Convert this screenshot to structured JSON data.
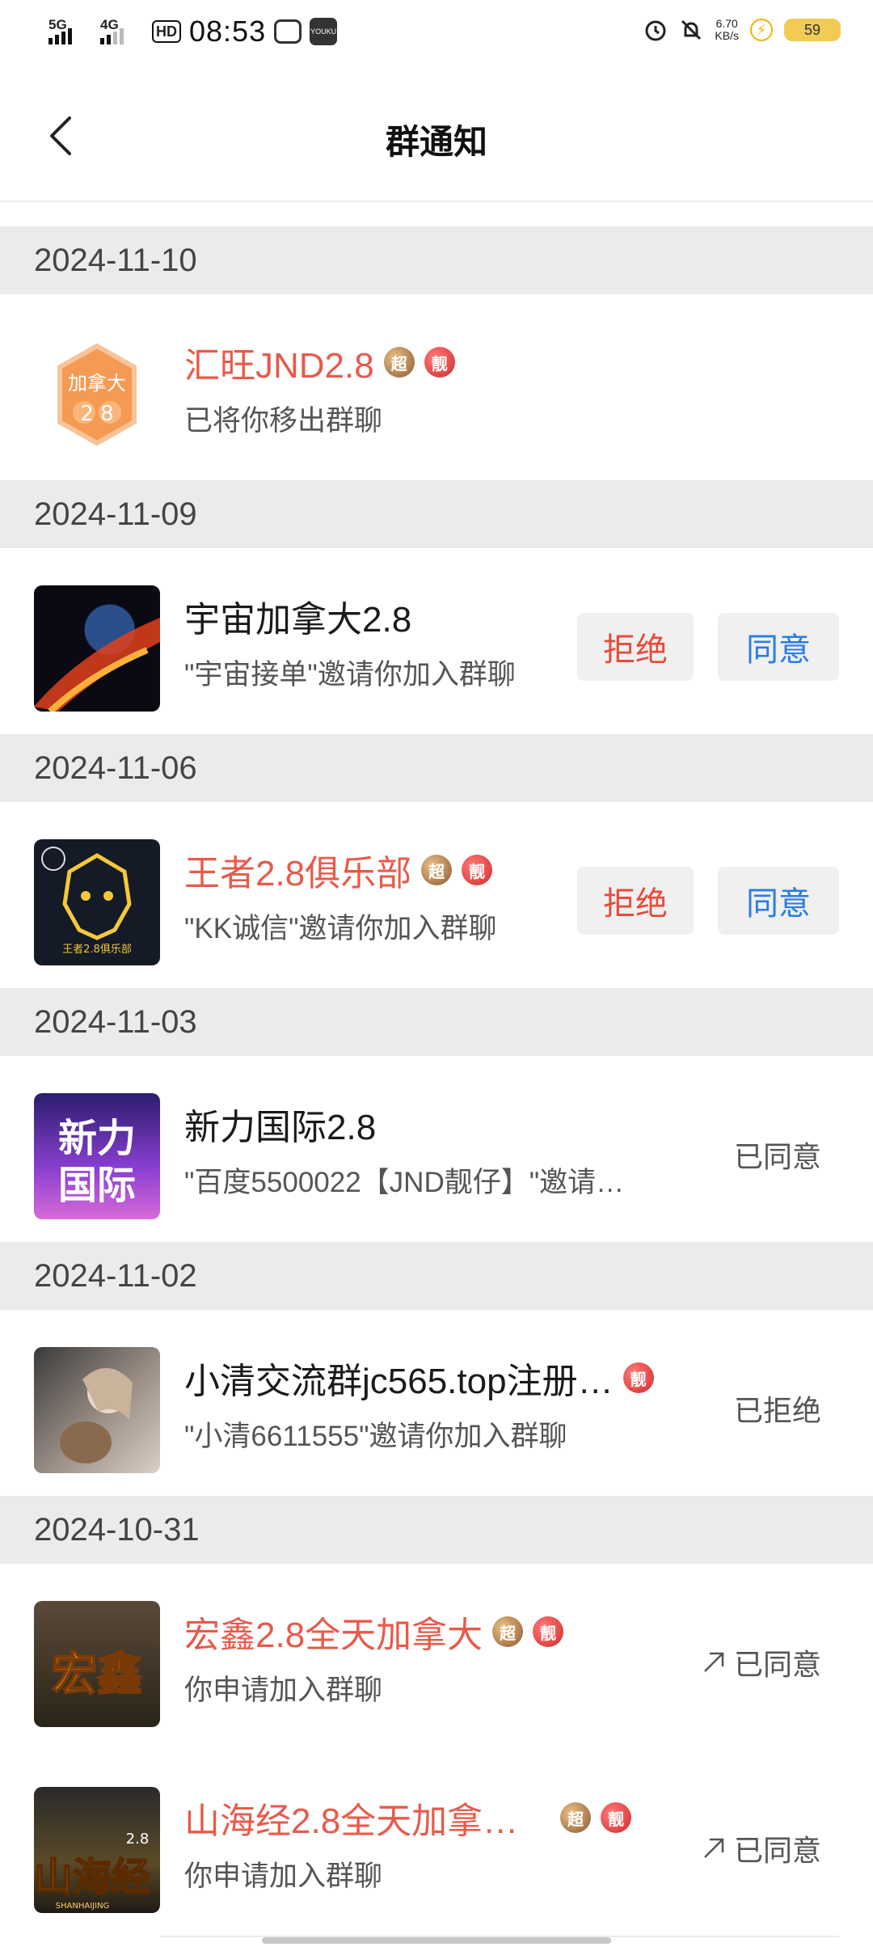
{
  "status_bar": {
    "signal1": "5G",
    "signal2": "4G",
    "hd": "HD",
    "time": "08:53",
    "net_speed_value": "6.70",
    "net_speed_unit": "KB/s",
    "battery": "59"
  },
  "header": {
    "title": "群通知"
  },
  "groups": [
    {
      "date": "2024-11-10",
      "items": [
        {
          "name": "汇旺JND2.8",
          "name_red": true,
          "badges": [
            "超",
            "靓"
          ],
          "sub": "已将你移出群聊",
          "avatar_text": "加拿大",
          "avatar_num": "2 8"
        }
      ]
    },
    {
      "date": "2024-11-09",
      "items": [
        {
          "name": "宇宙加拿大2.8",
          "sub": "\"宇宙接单\"邀请你加入群聊",
          "reject": "拒绝",
          "agree": "同意"
        }
      ]
    },
    {
      "date": "2024-11-06",
      "items": [
        {
          "name": "王者2.8俱乐部",
          "name_red": true,
          "badges": [
            "超",
            "靓"
          ],
          "sub": "\"KK诚信\"邀请你加入群聊",
          "reject": "拒绝",
          "agree": "同意",
          "avatar_text": "王者2.8俱乐部"
        }
      ]
    },
    {
      "date": "2024-11-03",
      "items": [
        {
          "name": "新力国际2.8",
          "sub": "\"百度5500022【JND靓仔】\"邀请…",
          "state": "已同意",
          "avatar_text1": "新力",
          "avatar_text2": "国际"
        }
      ]
    },
    {
      "date": "2024-11-02",
      "items": [
        {
          "name": "小清交流群jc565.top注册…",
          "badges": [
            "靓"
          ],
          "sub": "\"小清6611555\"邀请你加入群聊",
          "state": "已拒绝"
        }
      ]
    },
    {
      "date": "2024-10-31",
      "items": [
        {
          "name": "宏鑫2.8全天加拿大",
          "name_red": true,
          "badges": [
            "超",
            "靓"
          ],
          "sub": "你申请加入群聊",
          "state": "已同意",
          "avatar_text": "宏鑫"
        },
        {
          "name": "山海经2.8全天加拿…",
          "name_red": true,
          "badges": [
            "超",
            "靓"
          ],
          "sub": "你申请加入群聊",
          "state": "已同意",
          "avatar_text": "山海经",
          "avatar_small": "2.8",
          "avatar_en": "SHANHAIJING"
        }
      ]
    }
  ],
  "colors": {
    "red_name": "#e85a4a",
    "reject": "#e74a3b",
    "agree": "#2a7de1",
    "date_bg": "#ebebeb"
  }
}
